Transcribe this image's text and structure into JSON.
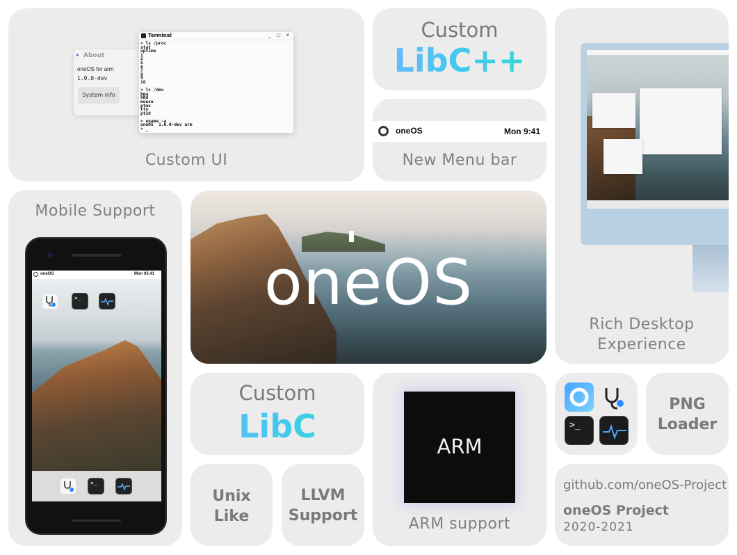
{
  "custom_ui": {
    "caption": "Custom UI",
    "about": {
      "title": "About",
      "name": "oneOS for arm",
      "version": "1.0.0-dev",
      "button": "System info"
    },
    "terminal": {
      "title": "Terminal",
      "controls": "_ □ ×",
      "output": "> ls /proc\nstat\nuptime\n1\n2\n5\n6\n7\n8\n9\n10\n\n> ls /dev\nbga\nkbd\nmouse\nptmx\ntty\npts0\n\n> uname -a\noneOS  1.0.0-dev arm\n> _"
    }
  },
  "libcpp": {
    "top": "Custom",
    "big": "LibC++"
  },
  "menubar": {
    "caption": "New Menu bar",
    "name": "oneOS",
    "clock": "Mon 9:41"
  },
  "desktop": {
    "caption_line1": "Rich Desktop",
    "caption_line2": "Experience"
  },
  "mobile": {
    "caption": "Mobile Support",
    "status_name": "oneOS",
    "status_clock": "Mon 03.41"
  },
  "hero": {
    "title": "oneOS"
  },
  "libc": {
    "top": "Custom",
    "big": "LibC"
  },
  "unix": {
    "line1": "Unix",
    "line2": "Like"
  },
  "llvm": {
    "line1": "LLVM",
    "line2": "Support"
  },
  "arm": {
    "chip": "ARM",
    "caption": "ARM support"
  },
  "png": {
    "line1": "PNG",
    "line2": "Loader"
  },
  "github": {
    "url": "github.com/oneOS-Project",
    "project": "oneOS Project",
    "years": "2020-2021"
  },
  "icons": [
    "about-app-icon",
    "terminal-app-icon",
    "monitor-app-icon",
    "oneos-logo-icon"
  ],
  "colors": {
    "card_bg": "#ececec",
    "caption_text": "#808080",
    "gradient_start": "#6ab8ff",
    "gradient_end": "#2ee0c8"
  }
}
